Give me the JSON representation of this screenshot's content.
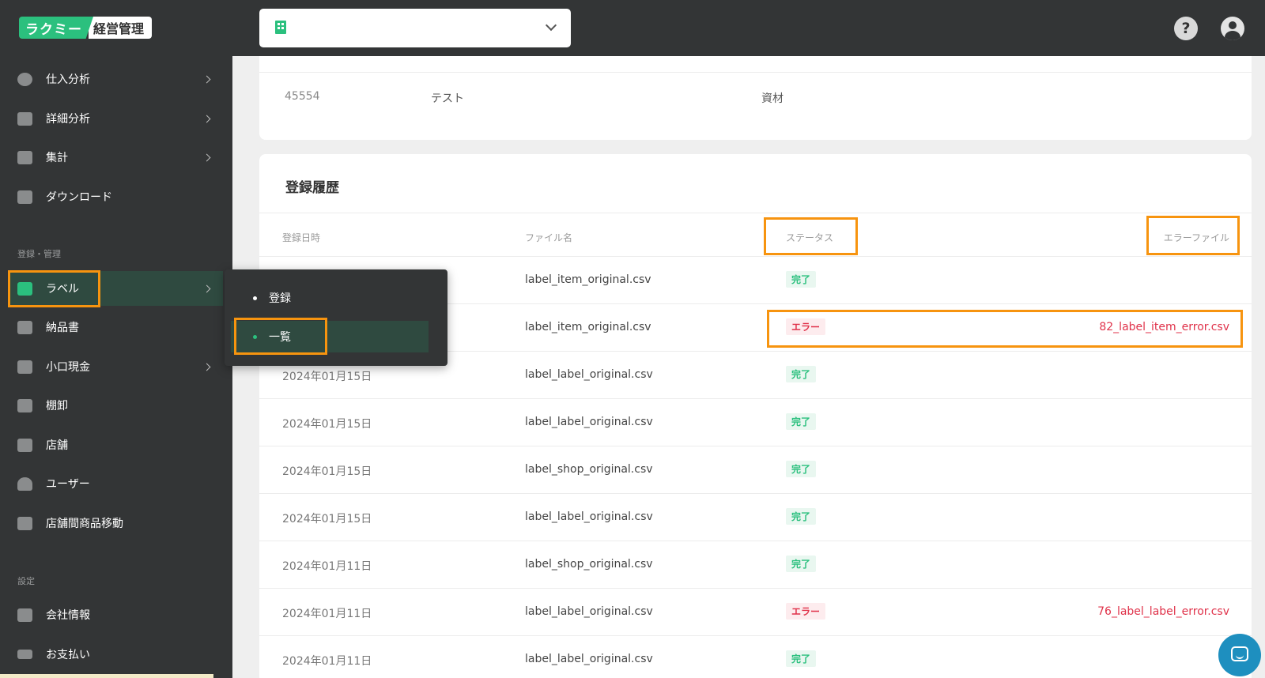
{
  "header": {
    "logo_left": "ラクミー",
    "logo_right": "経営管理",
    "store_selector_value": "",
    "help_glyph": "?"
  },
  "sidebar": {
    "items": [
      {
        "label": "仕入分析",
        "icon": "pie-chart-icon",
        "has_submenu": true
      },
      {
        "label": "詳細分析",
        "icon": "area-chart-icon",
        "has_submenu": true
      },
      {
        "label": "集計",
        "icon": "bar-chart-icon",
        "has_submenu": true
      },
      {
        "label": "ダウンロード",
        "icon": "download-icon",
        "has_submenu": false
      }
    ],
    "section_register": "登録・管理",
    "register_items": [
      {
        "label": "ラベル",
        "icon": "label-icon",
        "has_submenu": true,
        "active": true
      },
      {
        "label": "納品書",
        "icon": "receipt-icon",
        "has_submenu": false
      },
      {
        "label": "小口現金",
        "icon": "wallet-icon",
        "has_submenu": true
      },
      {
        "label": "棚卸",
        "icon": "grid-icon",
        "has_submenu": false
      },
      {
        "label": "店舗",
        "icon": "store-icon",
        "has_submenu": false
      },
      {
        "label": "ユーザー",
        "icon": "users-icon",
        "has_submenu": false
      },
      {
        "label": "店舗間商品移動",
        "icon": "transfer-icon",
        "has_submenu": false
      }
    ],
    "section_settings": "設定",
    "settings_items": [
      {
        "label": "会社情報",
        "icon": "briefcase-icon"
      },
      {
        "label": "お支払い",
        "icon": "credit-card-icon"
      }
    ]
  },
  "flyout": {
    "items": [
      {
        "label": "登録",
        "active": false
      },
      {
        "label": "一覧",
        "active": true
      }
    ]
  },
  "top_card": {
    "code": "45554",
    "name": "テスト",
    "category": "資材"
  },
  "history": {
    "title": "登録履歴",
    "columns": [
      "登録日時",
      "ファイル名",
      "ステータス",
      "エラーファイル"
    ],
    "rows": [
      {
        "date": "",
        "file": "label_item_original.csv",
        "status": "完了",
        "status_type": "ok",
        "error_file": ""
      },
      {
        "date": "",
        "file": "label_item_original.csv",
        "status": "エラー",
        "status_type": "err",
        "error_file": "82_label_item_error.csv"
      },
      {
        "date": "2024年01月15日",
        "file": "label_label_original.csv",
        "status": "完了",
        "status_type": "ok",
        "error_file": ""
      },
      {
        "date": "2024年01月15日",
        "file": "label_label_original.csv",
        "status": "完了",
        "status_type": "ok",
        "error_file": ""
      },
      {
        "date": "2024年01月15日",
        "file": "label_shop_original.csv",
        "status": "完了",
        "status_type": "ok",
        "error_file": ""
      },
      {
        "date": "2024年01月15日",
        "file": "label_label_original.csv",
        "status": "完了",
        "status_type": "ok",
        "error_file": ""
      },
      {
        "date": "2024年01月11日",
        "file": "label_shop_original.csv",
        "status": "完了",
        "status_type": "ok",
        "error_file": ""
      },
      {
        "date": "2024年01月11日",
        "file": "label_label_original.csv",
        "status": "エラー",
        "status_type": "err",
        "error_file": "76_label_label_error.csv"
      },
      {
        "date": "2024年01月11日",
        "file": "label_label_original.csv",
        "status": "完了",
        "status_type": "ok",
        "error_file": ""
      }
    ]
  },
  "colors": {
    "accent": "#2bc07e",
    "error": "#e0324a",
    "highlight": "#f7940f",
    "sidebar_bg": "#333536"
  }
}
